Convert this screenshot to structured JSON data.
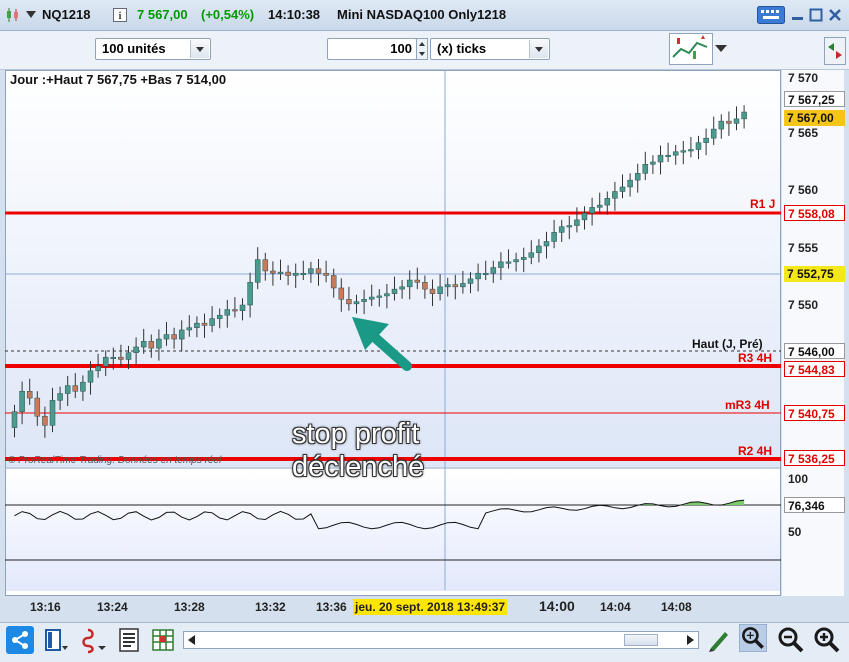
{
  "title": {
    "symbol": "NQ1218",
    "price": "7 567,00",
    "change": "(+0,54%)",
    "time": "14:10:38",
    "name": "Mini NASDAQ100 Only1218",
    "price_color": "#009a00"
  },
  "toolbar": {
    "units": "100 unités",
    "ticks_value": "100",
    "ticks_label": "(x) ticks"
  },
  "chart_info": "Jour :+Haut 7 567,75 +Bas 7 514,00",
  "copyright": "© ProRealTime Trading. Données en temps réel",
  "annotation": {
    "line1": "stop profit",
    "line2": "déclenché"
  },
  "levels": {
    "r1j": {
      "label": "R1 J",
      "value": "7 558,08"
    },
    "current": "7 552,75",
    "haut": {
      "label": "Haut (J, Pré)",
      "value": "7 546,00"
    },
    "r34h": {
      "label": "R3 4H",
      "value": "7 544,83"
    },
    "mr34h": {
      "label": "mR3 4H",
      "value": "7 540,75"
    },
    "r24h": {
      "label": "R2 4H",
      "value": "7 536,25"
    }
  },
  "price_axis": {
    "ticks": [
      "7 570",
      "7 565",
      "7 560",
      "7 555",
      "7 550"
    ],
    "last_high": "7 567,25",
    "last": "7 567,00"
  },
  "indicator": {
    "value": "76,346",
    "ticks": [
      "100",
      "50"
    ]
  },
  "time_axis": {
    "ticks": [
      "13:16",
      "13:24",
      "13:28",
      "13:32",
      "13:36",
      "14:00",
      "14:04",
      "14:08"
    ],
    "cursor": "jeu. 20 sept. 2018 13:49:37"
  },
  "colors": {
    "bull": "#4a9a8e",
    "bear": "#c97a5a",
    "level": "#ee0000",
    "accent": "#1a9a86"
  },
  "chart_data": {
    "type": "candlestick",
    "x_ticks": [
      "13:16",
      "13:24",
      "13:28",
      "13:32",
      "13:36",
      "14:00",
      "14:04",
      "14:08"
    ],
    "y_ticks": [
      7570,
      7565,
      7560,
      7555,
      7550
    ],
    "levels": [
      7558.08,
      7552.75,
      7546.0,
      7544.83,
      7540.75,
      7536.25
    ],
    "close": [
      7540.6,
      7542.4,
      7541.8,
      7540.2,
      7539.4,
      7541.6,
      7542.2,
      7542.9,
      7542.4,
      7543.2,
      7544.2,
      7544.6,
      7545.4,
      7545.4,
      7545.2,
      7545.8,
      7546.3,
      7546.8,
      7546.2,
      7547.0,
      7547.4,
      7547.0,
      7547.8,
      7548.0,
      7548.4,
      7548.2,
      7548.8,
      7549.1,
      7549.6,
      7549.5,
      7550.0,
      7552.0,
      7554.0,
      7553.0,
      7552.8,
      7552.9,
      7552.6,
      7552.8,
      7552.8,
      7553.2,
      7552.8,
      7552.6,
      7551.5,
      7550.5,
      7550.1,
      7550.3,
      7550.5,
      7550.7,
      7550.8,
      7551.0,
      7551.4,
      7551.6,
      7552.2,
      7552.0,
      7551.4,
      7551.0,
      7551.6,
      7551.8,
      7551.6,
      7551.9,
      7552.3,
      7552.8,
      7552.8,
      7553.3,
      7553.8,
      7553.8,
      7554.0,
      7554.2,
      7554.6,
      7555.2,
      7555.6,
      7556.4,
      7556.9,
      7557.0,
      7557.5,
      7558.1,
      7558.6,
      7558.8,
      7559.4,
      7560.0,
      7560.4,
      7561.0,
      7561.6,
      7562.4,
      7562.6,
      7563.2,
      7563.2,
      7563.5,
      7563.6,
      7563.7,
      7564.3,
      7564.7,
      7565.5,
      7566.2,
      7566.0,
      7566.4,
      7567.0
    ],
    "indicator": {
      "value": 76.346,
      "ticks": [
        100,
        50
      ]
    }
  }
}
